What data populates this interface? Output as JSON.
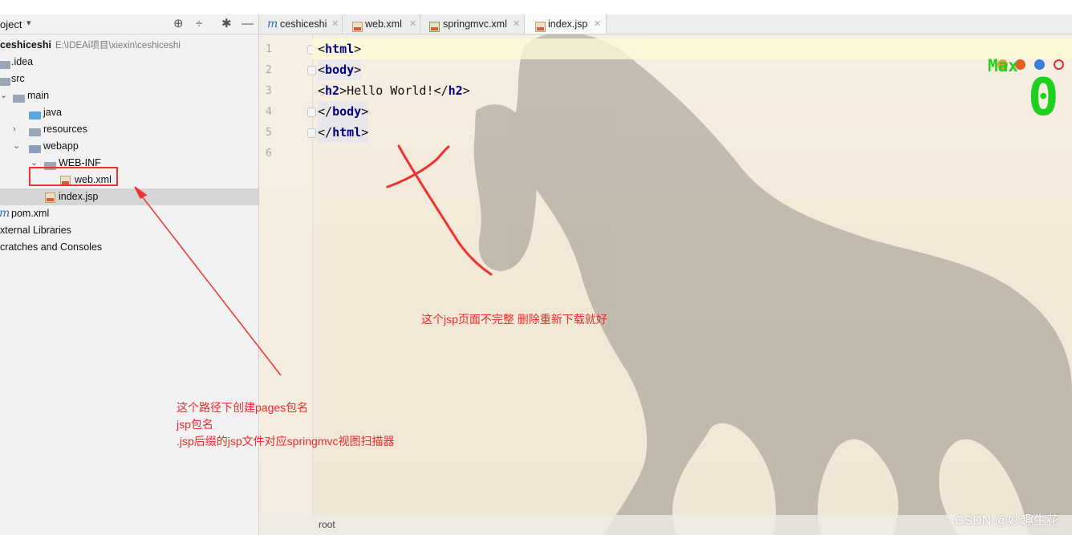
{
  "project_panel": {
    "title": "oject",
    "tree": [
      {
        "label": "ceshiceshi",
        "path": "E:\\IDEAi项目\\xiexin\\ceshiceshi",
        "bold": true
      },
      {
        "label": ".idea"
      },
      {
        "label": "src"
      },
      {
        "label": "main"
      },
      {
        "label": "java"
      },
      {
        "label": "resources"
      },
      {
        "label": "webapp"
      },
      {
        "label": "WEB-INF"
      },
      {
        "label": "web.xml"
      },
      {
        "label": "index.jsp"
      },
      {
        "label": "pom.xml"
      },
      {
        "label": "xternal Libraries"
      },
      {
        "label": "cratches and Consoles"
      }
    ]
  },
  "tabs": [
    {
      "label": "ceshiceshi",
      "icon": "maven-icon"
    },
    {
      "label": "web.xml",
      "icon": "xml-file-icon"
    },
    {
      "label": "springmvc.xml",
      "icon": "spring-xml-icon"
    },
    {
      "label": "index.jsp",
      "icon": "jsp-file-icon",
      "active": true
    }
  ],
  "editor": {
    "line_numbers": [
      "1",
      "2",
      "3",
      "4",
      "5",
      "6"
    ],
    "code": {
      "l1": {
        "open": "<",
        "tag": "html",
        "close": ">"
      },
      "l2": {
        "open": "<",
        "tag": "body",
        "close": ">"
      },
      "l3": {
        "open": "<",
        "tag": "h2",
        "mid": ">Hello World!</",
        "tag2": "h2",
        "close": ">"
      },
      "l4": {
        "open": "</",
        "tag": "body",
        "close": ">"
      },
      "l5": {
        "open": "</",
        "tag": "html",
        "close": ">"
      }
    },
    "status_text": "root"
  },
  "annotations": {
    "note_right": "这个jsp页面不完整 删除重新下载就好",
    "note_left": [
      "这个路径下创建pages包名",
      "jsp包名",
      ".jsp后缀的jsp文件对应springmvc视图扫描器"
    ]
  },
  "overlay_counter": {
    "label": "Max",
    "value": "0",
    "color": "#20d020"
  },
  "watermark": "CSDN @妙趣生花",
  "colors": {
    "annotation": "#ef2a2a",
    "tag": "#000080",
    "counter": "#20d020"
  }
}
